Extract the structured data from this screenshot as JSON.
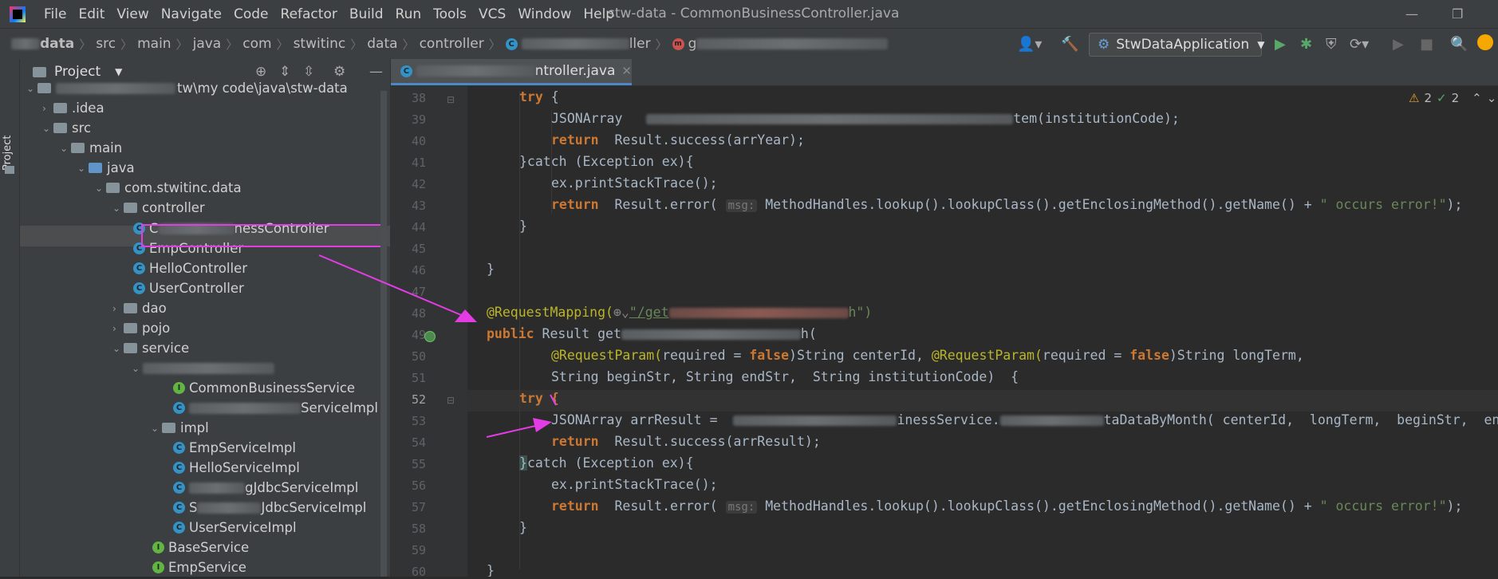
{
  "menu": [
    "File",
    "Edit",
    "View",
    "Navigate",
    "Code",
    "Refactor",
    "Build",
    "Run",
    "Tools",
    "VCS",
    "Window",
    "Help"
  ],
  "window_title": "stw-data - CommonBusinessController.java",
  "breadcrumbs": {
    "project": "data",
    "items": [
      "src",
      "main",
      "java",
      "com",
      "stwitinc",
      "data",
      "controller"
    ],
    "class_suffix": "ller",
    "method_prefix": "g"
  },
  "run_config": "StwDataApplication",
  "colors": {
    "accent": "#e43ce4",
    "background": "#2b2b2b",
    "panel": "#3c3f41"
  },
  "project_panel": {
    "title": "Project",
    "root_path": "tw\\my code\\java\\stw-data",
    "tree": {
      "idea": ".idea",
      "src": "src",
      "main": "main",
      "java": "java",
      "package": "com.stwitinc.data",
      "controller": "controller",
      "selected_prefix": "C",
      "selected_suffix": "nessController",
      "emp_controller": "EmpController",
      "hello_controller": "HelloController",
      "user_controller": "UserController",
      "dao": "dao",
      "pojo": "pojo",
      "service": "service",
      "common_service": "CommonBusinessService",
      "service_impl_suffix": "ServiceImpl",
      "impl": "impl",
      "emp_impl": "EmpServiceImpl",
      "hello_impl": "HelloServiceImpl",
      "jdbc1_suffix": "gJdbcServiceImpl",
      "jdbc2_prefix": "S",
      "jdbc2_suffix": "JdbcServiceImpl",
      "user_impl": "UserServiceImpl",
      "base_service": "BaseService",
      "emp_service": "EmpService"
    }
  },
  "editor": {
    "tab_suffix": "ntroller.java",
    "inspections": {
      "warnings": "2",
      "ok": "2"
    },
    "line_numbers": [
      "38",
      "39",
      "40",
      "41",
      "42",
      "43",
      "44",
      "45",
      "46",
      "47",
      "48",
      "49",
      "50",
      "51",
      "52",
      "53",
      "54",
      "55",
      "56",
      "57",
      "58",
      "59",
      "60"
    ],
    "code": {
      "l38_try": "try",
      "l39_type": "JSONArray",
      "l39_tail": "tem(institutionCode);",
      "l40_return": "return",
      "l40_call": "Result.success(arrYear);",
      "l41_catch": "}catch (Exception ex){",
      "l42": "ex.printStackTrace();",
      "l43_prefix": "Result.error(",
      "l43_hint": "msg:",
      "l43_rest": "MethodHandles.lookup().lookupClass().getEnclosingMethod().getName() + ",
      "l43_str": "\" occurs error!\"",
      "l43_end": ");",
      "l44": "}",
      "l46": "}",
      "l48_ann": "@RequestMapping(",
      "l48_path_prefix": "\"/get",
      "l48_path_suffix": "h\")",
      "l49_public": "public",
      "l49_type": "Result get",
      "l49_tail": "h(",
      "l50_param_ann": "@RequestParam(",
      "l50_required": "required = ",
      "l50_false": "false",
      "l50_p1": ")String centerId, ",
      "l50_p2": ")String longTerm,",
      "l51": "String beginStr, String endStr,  String institutionCode)  {",
      "l52_try": "try {",
      "l53_prefix": "JSONArray arrResult =  ",
      "l53_service": "inessService.",
      "l53_tail": "taDataByMonth( centerId,  longTerm,  beginStr,  endStr,  inst",
      "l54_call": "Result.success(arrResult);",
      "l55_catch": "catch (Exception ex){",
      "l56": "ex.printStackTrace();",
      "l58": "}",
      "l60": "}"
    }
  }
}
